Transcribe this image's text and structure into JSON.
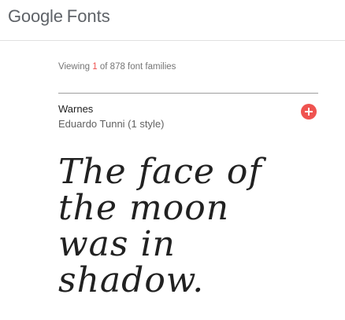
{
  "header": {
    "brand": "Google",
    "product": "Fonts"
  },
  "results": {
    "prefix": "Viewing",
    "count": "1",
    "suffix": "of 878 font families"
  },
  "font_card": {
    "name": "Warnes",
    "meta": "Eduardo Tunni (1 style)",
    "add_icon": "plus-circle-icon",
    "sample_lines": [
      "The face of",
      "the moon",
      "was in",
      "shadow."
    ]
  },
  "colors": {
    "accent": "#ef5350",
    "logo": "#5f6368",
    "text": "#212121",
    "muted": "#757575"
  }
}
